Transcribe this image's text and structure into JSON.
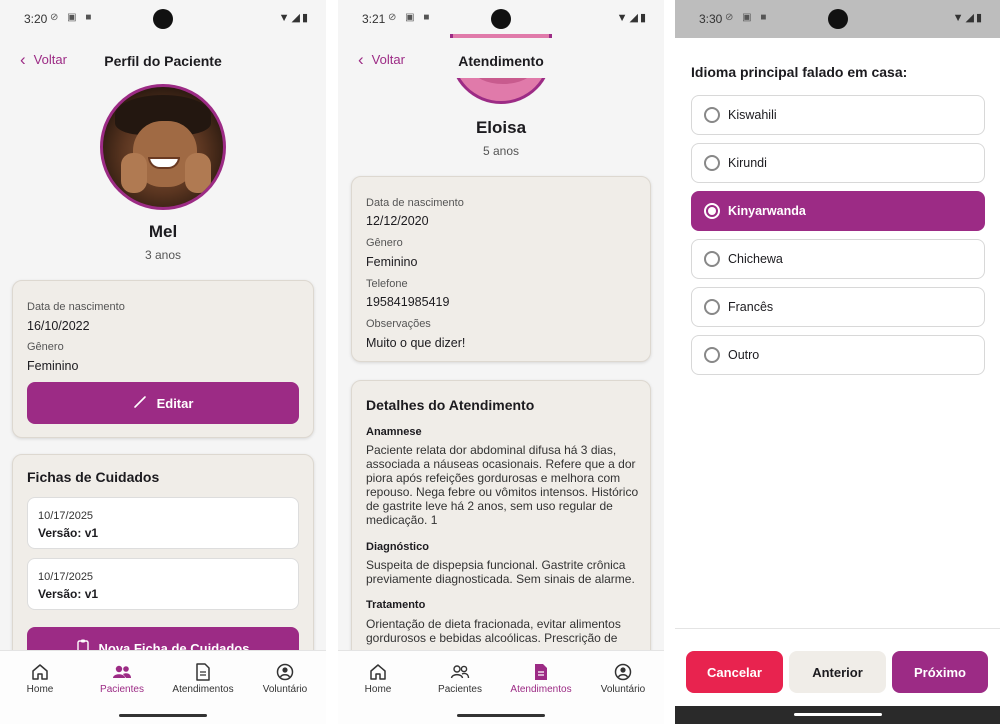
{
  "colors": {
    "accent": "#9c2b85",
    "danger": "#e8234f",
    "card": "#f0ede8"
  },
  "screen1": {
    "status_time": "3:20",
    "back_label": "Voltar",
    "title": "Perfil do Paciente",
    "patient_name": "Mel",
    "patient_age": "3 anos",
    "birth_label": "Data de nascimento",
    "birth_value": "16/10/2022",
    "gender_label": "Gênero",
    "gender_value": "Feminino",
    "edit_label": "Editar",
    "fichas_title": "Fichas de Cuidados",
    "fichas": [
      {
        "date": "10/17/2025",
        "version": "Versão: v1"
      },
      {
        "date": "10/17/2025",
        "version": "Versão: v1"
      }
    ],
    "new_ficha_label": "Nova Ficha de Cuidados"
  },
  "screen2": {
    "status_time": "3:21",
    "back_label": "Voltar",
    "title": "Atendimento",
    "patient_name": "Eloisa",
    "patient_age": "5 anos",
    "birth_label": "Data de nascimento",
    "birth_value": "12/12/2020",
    "gender_label": "Gênero",
    "gender_value": "Feminino",
    "phone_label": "Telefone",
    "phone_value": "195841985419",
    "obs_label": "Observações",
    "obs_value": "Muito o que dizer!",
    "details_title": "Detalhes do Atendimento",
    "anamnese_label": "Anamnese",
    "anamnese_text": "Paciente relata dor abdominal difusa há 3 dias, associada a náuseas ocasionais. Refere que a dor piora após refeições gordurosas e melhora com repouso. Nega febre ou vômitos intensos. Histórico de gastrite leve há 2 anos, sem uso regular de medicação. 1",
    "diagnostico_label": "Diagnóstico",
    "diagnostico_text": "Suspeita de dispepsia funcional. Gastrite crônica previamente diagnosticada. Sem sinais de alarme.",
    "tratamento_label": "Tratamento",
    "tratamento_text": "Orientação de dieta fracionada, evitar alimentos gordurosos e bebidas alcoólicas. Prescrição de"
  },
  "nav": {
    "home": "Home",
    "pacientes": "Pacientes",
    "atendimentos": "Atendimentos",
    "voluntario": "Voluntário"
  },
  "screen3": {
    "status_time": "3:30",
    "question": "Idioma principal falado em casa:",
    "options": [
      "Kiswahili",
      "Kirundi",
      "Kinyarwanda",
      "Chichewa",
      "Francês",
      "Outro"
    ],
    "selected": "Kinyarwanda",
    "cancel_label": "Cancelar",
    "previous_label": "Anterior",
    "next_label": "Próximo"
  }
}
